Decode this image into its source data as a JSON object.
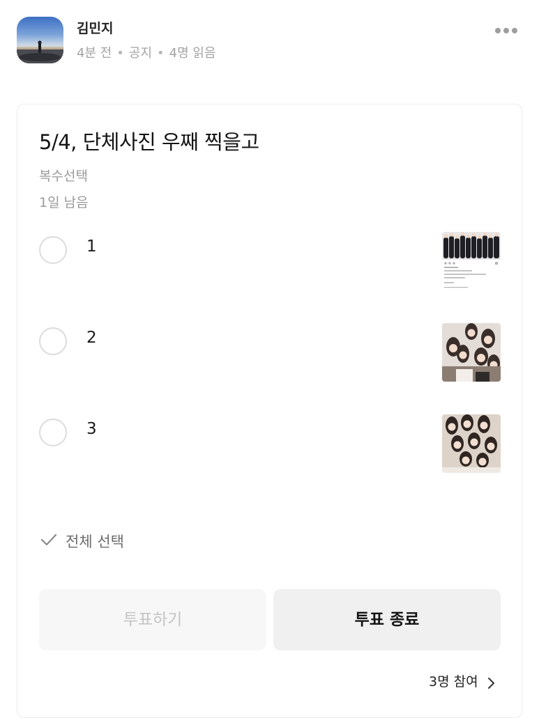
{
  "post": {
    "author": "김민지",
    "time": "4분 전",
    "category": "공지",
    "reads": "4명 읽음",
    "separator": "•"
  },
  "poll": {
    "title": "5/4, 단체사진 우째 찍을고",
    "type": "복수선택",
    "remaining": "1일 남음",
    "options": [
      {
        "label": "1",
        "selected": false
      },
      {
        "label": "2",
        "selected": false
      },
      {
        "label": "3",
        "selected": false
      }
    ],
    "select_all": "전체 선택",
    "vote_button": "투표하기",
    "end_button": "투표 종료",
    "participants": "3명 참여"
  },
  "colors": {
    "meta_gray": "#a3a3a3",
    "radio_border": "#dcdcdc",
    "disabled_text": "#c5c5c5",
    "button_bg": "#f0f0f0"
  },
  "icons": {
    "more": "more-horizontal-icon",
    "check": "check-icon",
    "chevron": "chevron-right-icon"
  }
}
